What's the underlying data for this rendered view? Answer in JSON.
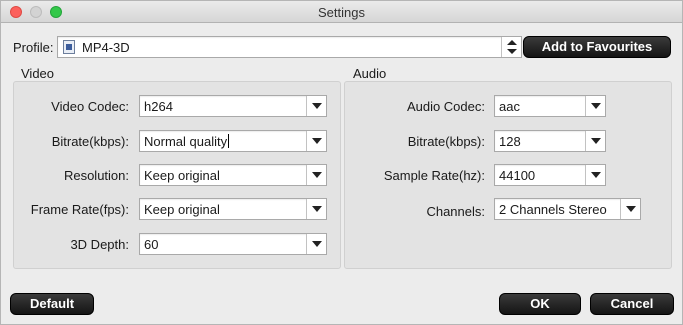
{
  "window": {
    "title": "Settings"
  },
  "profile": {
    "label": "Profile:",
    "value": "MP4-3D",
    "add_favourites": "Add to Favourites"
  },
  "video": {
    "title": "Video",
    "codec": {
      "label": "Video Codec:",
      "value": "h264"
    },
    "bitrate": {
      "label": "Bitrate(kbps):",
      "value": "Normal quality"
    },
    "resolution": {
      "label": "Resolution:",
      "value": "Keep original"
    },
    "frame_rate": {
      "label": "Frame Rate(fps):",
      "value": "Keep original"
    },
    "depth": {
      "label": "3D Depth:",
      "value": "60"
    }
  },
  "audio": {
    "title": "Audio",
    "codec": {
      "label": "Audio Codec:",
      "value": "aac"
    },
    "bitrate": {
      "label": "Bitrate(kbps):",
      "value": "128"
    },
    "sample_rate": {
      "label": "Sample Rate(hz):",
      "value": "44100"
    },
    "channels": {
      "label": "Channels:",
      "value": "2 Channels Stereo"
    }
  },
  "buttons": {
    "default": "Default",
    "ok": "OK",
    "cancel": "Cancel"
  }
}
